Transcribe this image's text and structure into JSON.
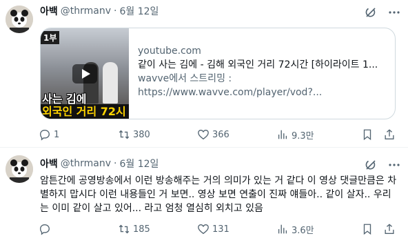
{
  "tweets": [
    {
      "author": {
        "name": "아백",
        "handle": "@thrmanv",
        "separator": "·",
        "date": "6월 12일"
      },
      "card": {
        "thumbnail": {
          "tag": "1부",
          "caption_line1": "사는 김에",
          "caption_line2": "외국인 거리 72시"
        },
        "domain": "youtube.com",
        "title": "같이 사는 김에 - 김해 외국인 거리 72시간 [하이라이트 1...",
        "desc_line1": "wavve에서 스트리밍 :",
        "desc_line2": "https://www.wavve.com/player/vod?..."
      },
      "actions": {
        "reply": "1",
        "retweet": "380",
        "like": "366",
        "views": "9.3만"
      }
    },
    {
      "author": {
        "name": "아백",
        "handle": "@thrmanv",
        "separator": "·",
        "date": "6월 12일"
      },
      "body": "암튼간에 공영방송에서 이런 방송해주는 거의 의미가 있는 거 같다 이 영상 댓글만큼은 차별하지 맙시다 이런 내용들인 거 보면.. 영상 보면 연출이 진짜 얘들아.. 같이 살자.. 우리는 이미 같이 살고 있어... 라고 엄청 열심히 외치고 있음",
      "actions": {
        "reply": "",
        "retweet": "185",
        "like": "131",
        "views": "3.6만"
      }
    }
  ],
  "icons": [
    "avatar",
    "grok-icon",
    "more-icon",
    "reply-icon",
    "retweet-icon",
    "like-icon",
    "views-icon",
    "bookmark-icon",
    "share-icon"
  ],
  "colors": {
    "text": "#0f1419",
    "secondary": "#536471",
    "border": "#cfd9de"
  }
}
